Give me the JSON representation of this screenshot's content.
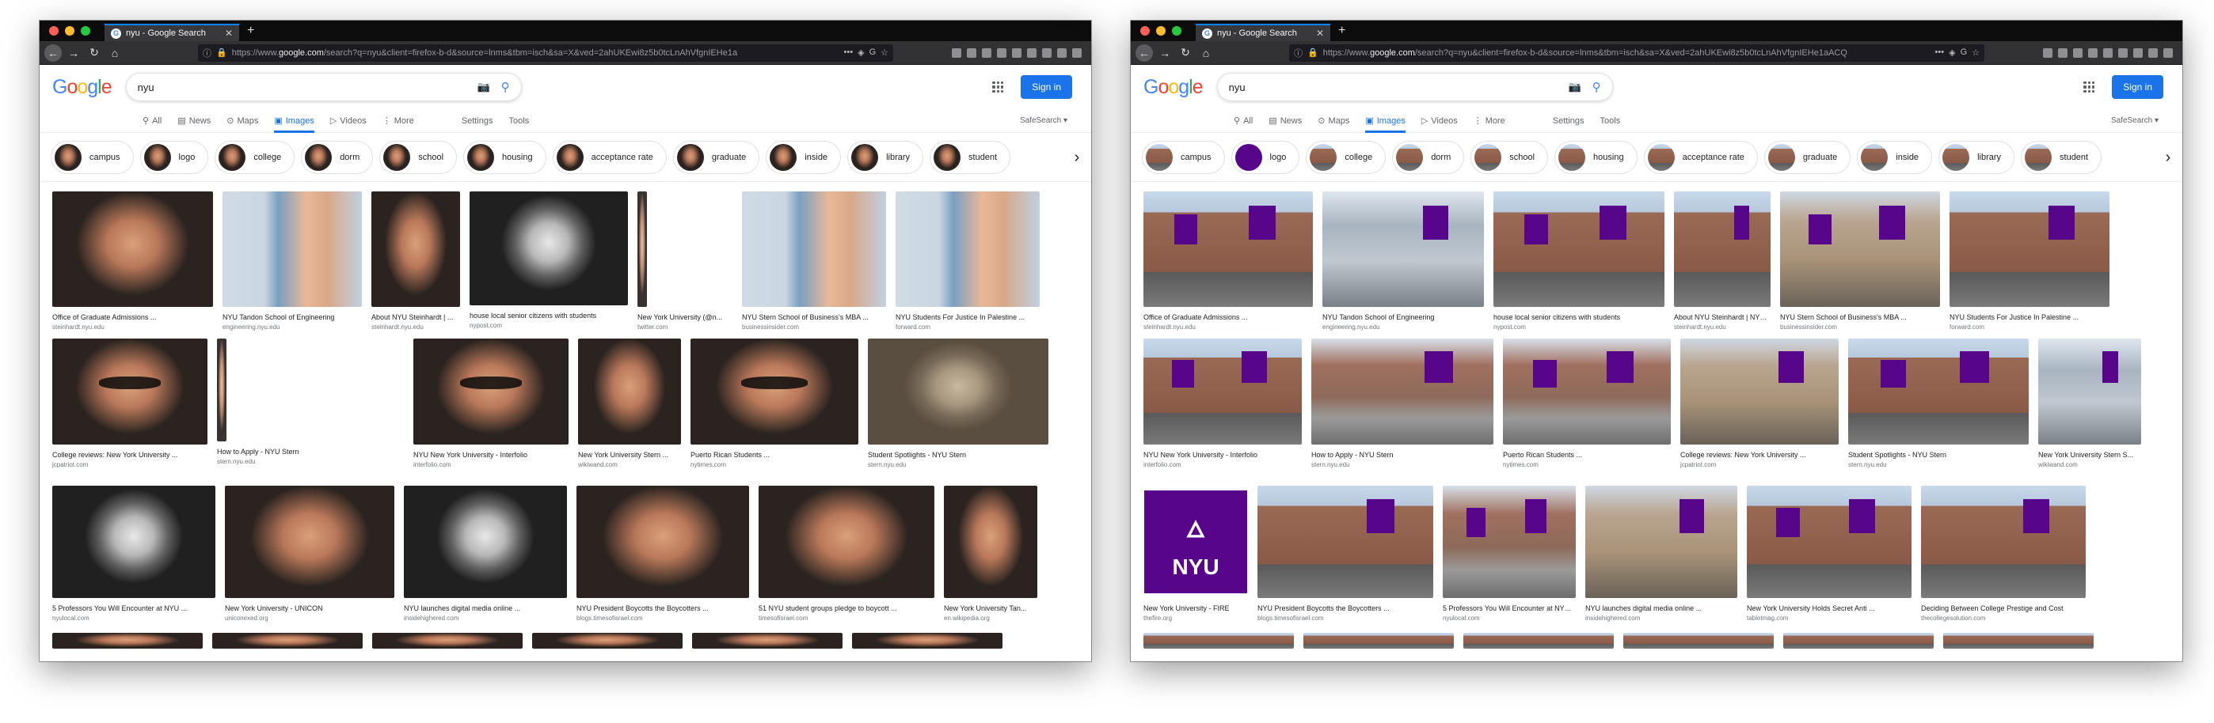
{
  "browser": {
    "tab_title": "nyu - Google Search",
    "url_prefix": "https://www.",
    "url_domain": "google.com",
    "url_rest_left": "/search?q=nyu&client=firefox-b-d&source=lnms&tbm=isch&sa=X&ved=2ahUKEwi8z5b0tcLnAhVfgnIEHe1a",
    "url_rest_right": "/search?q=nyu&client=firefox-b-d&source=lnms&tbm=isch&sa=X&ved=2ahUKEwi8z5b0tcLnAhVfgnIEHe1aACQ"
  },
  "google": {
    "logo": "Google",
    "query": "nyu",
    "sign_in": "Sign in",
    "tabs": [
      "All",
      "News",
      "Maps",
      "Images",
      "Videos",
      "More"
    ],
    "tab_icons": [
      "search-icon",
      "news-icon",
      "pin-icon",
      "image-icon",
      "video-icon",
      "more-icon"
    ],
    "settings": "Settings",
    "tools": "Tools",
    "safesearch": "SafeSearch ▾"
  },
  "chips": [
    "campus",
    "logo",
    "college",
    "dorm",
    "school",
    "housing",
    "acceptance rate",
    "graduate",
    "inside",
    "library",
    "student"
  ],
  "left_results": [
    [
      {
        "caption": "Office of Graduate Admissions ...",
        "source": "steinhardt.nyu.edu"
      },
      {
        "caption": "NYU Tandon School of Engineering",
        "source": "engineering.nyu.edu"
      },
      {
        "caption": "About NYU Steinhardt | ...",
        "source": "steinhardt.nyu.edu"
      },
      {
        "caption": "house local senior citizens with students",
        "source": "nypost.com"
      },
      {
        "caption": "New York University (@n...",
        "source": "twitter.com"
      },
      {
        "caption": "NYU Stern School of Business's MBA ...",
        "source": "businessinsider.com"
      },
      {
        "caption": "NYU Students For Justice In Palestine ...",
        "source": "forward.com"
      }
    ],
    [
      {
        "caption": "College reviews: New York University ...",
        "source": "jcpatriot.com"
      },
      {
        "caption": "How to Apply - NYU Stern",
        "source": "stern.nyu.edu"
      },
      {
        "caption": "NYU New York University - Interfolio",
        "source": "interfolio.com"
      },
      {
        "caption": "New York University Stern ...",
        "source": "wikiwand.com"
      },
      {
        "caption": "Puerto Rican Students ...",
        "source": "nytimes.com"
      },
      {
        "caption": "Student Spotlights - NYU Stern",
        "source": "stern.nyu.edu"
      }
    ],
    [
      {
        "caption": "5 Professors You Will Encounter at NYU ...",
        "source": "nyulocal.com"
      },
      {
        "caption": "New York University - UNICON",
        "source": "uniconexed.org"
      },
      {
        "caption": "NYU launches digital media online ...",
        "source": "insidehighered.com"
      },
      {
        "caption": "NYU President Boycotts the Boycotters ...",
        "source": "blogs.timesofisrael.com"
      },
      {
        "caption": "51 NYU student groups pledge to boycott ...",
        "source": "timesofisrael.com"
      },
      {
        "caption": "New York University Tan...",
        "source": "en.wikipedia.org"
      }
    ]
  ],
  "right_results": [
    [
      {
        "caption": "Office of Graduate Admissions ...",
        "source": "steinhardt.nyu.edu"
      },
      {
        "caption": "NYU Tandon School of Engineering",
        "source": "engineering.nyu.edu"
      },
      {
        "caption": "house local senior citizens with students",
        "source": "nypost.com"
      },
      {
        "caption": "About NYU Steinhardt | NYU...",
        "source": "steinhardt.nyu.edu"
      },
      {
        "caption": "NYU Stern School of Business's MBA ...",
        "source": "businessinsider.com"
      },
      {
        "caption": "NYU Students For Justice In Palestine ...",
        "source": "forward.com"
      }
    ],
    [
      {
        "caption": "NYU New York University - Interfolio",
        "source": "interfolio.com"
      },
      {
        "caption": "How to Apply - NYU Stern",
        "source": "stern.nyu.edu"
      },
      {
        "caption": "Puerto Rican Students ...",
        "source": "nytimes.com"
      },
      {
        "caption": "College reviews: New York University ...",
        "source": "jcpatriot.com"
      },
      {
        "caption": "Student Spotlights - NYU Stern",
        "source": "stern.nyu.edu"
      },
      {
        "caption": "New York University Stern S...",
        "source": "wikiwand.com"
      }
    ],
    [
      {
        "caption": "New York University - FIRE",
        "source": "thefire.org",
        "logo_text": "NYU"
      },
      {
        "caption": "NYU President Boycotts the Boycotters ...",
        "source": "blogs.timesofisrael.com"
      },
      {
        "caption": "5 Professors You Will Encounter at NYU ...",
        "source": "nyulocal.com"
      },
      {
        "caption": "NYU launches digital media online ...",
        "source": "insidehighered.com"
      },
      {
        "caption": "New York University Holds Secret Anti ...",
        "source": "tabletmag.com"
      },
      {
        "caption": "Deciding Between College Prestige and Cost",
        "source": "thecollegesolution.com"
      }
    ]
  ],
  "colors": {
    "accent": "#1a73e8",
    "nyu_violet": "#57068c",
    "google_blue": "#4285F4",
    "google_red": "#EA4335",
    "google_yellow": "#FBBC05",
    "google_green": "#34A853"
  }
}
